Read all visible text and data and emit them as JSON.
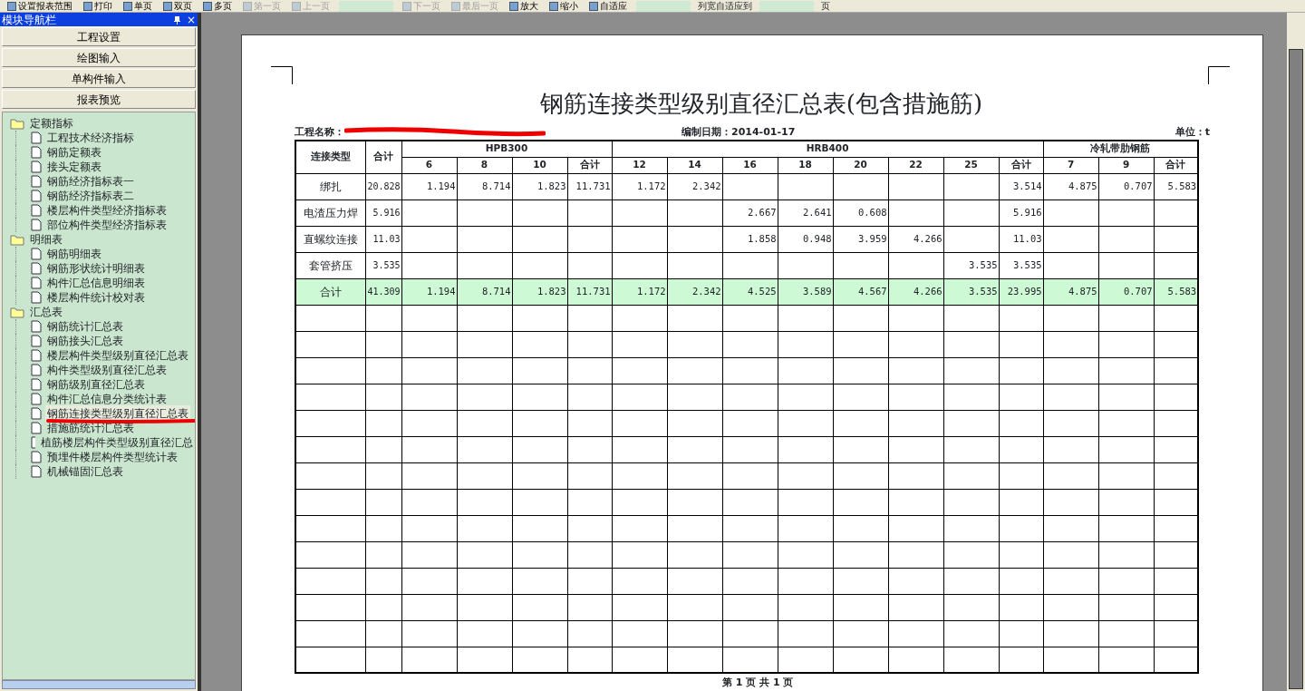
{
  "toolbar": [
    {
      "kind": "button",
      "label": "设置报表范围",
      "disabled": false
    },
    {
      "kind": "button",
      "label": "打印",
      "disabled": false
    },
    {
      "kind": "button",
      "label": "单页",
      "disabled": false
    },
    {
      "kind": "button",
      "label": "双页",
      "disabled": false
    },
    {
      "kind": "button",
      "label": "多页",
      "disabled": false
    },
    {
      "kind": "button",
      "label": "第一页",
      "disabled": true
    },
    {
      "kind": "button",
      "label": "上一页",
      "disabled": true
    },
    {
      "kind": "field"
    },
    {
      "kind": "button",
      "label": "下一页",
      "disabled": true
    },
    {
      "kind": "button",
      "label": "最后一页",
      "disabled": true
    },
    {
      "kind": "button",
      "label": "放大",
      "disabled": false
    },
    {
      "kind": "button",
      "label": "缩小",
      "disabled": false
    },
    {
      "kind": "button",
      "label": "自适应",
      "disabled": false
    },
    {
      "kind": "field"
    },
    {
      "kind": "text",
      "label": "列宽自适应到"
    },
    {
      "kind": "field"
    },
    {
      "kind": "text",
      "label": "页"
    }
  ],
  "panel": {
    "title": "模块导航栏",
    "close": "×",
    "sections": [
      {
        "label": "工程设置"
      },
      {
        "label": "绘图输入"
      },
      {
        "label": "单构件输入"
      },
      {
        "label": "报表预览"
      }
    ],
    "tree": [
      {
        "label": "定额指标",
        "children": [
          {
            "label": "工程技术经济指标",
            "selected": false
          },
          {
            "label": "钢筋定额表",
            "selected": false
          },
          {
            "label": "接头定额表",
            "selected": false
          },
          {
            "label": "钢筋经济指标表一",
            "selected": false
          },
          {
            "label": "钢筋经济指标表二",
            "selected": false
          },
          {
            "label": "楼层构件类型经济指标表",
            "selected": false
          },
          {
            "label": "部位构件类型经济指标表",
            "selected": false
          }
        ]
      },
      {
        "label": "明细表",
        "children": [
          {
            "label": "钢筋明细表",
            "selected": false
          },
          {
            "label": "钢筋形状统计明细表",
            "selected": false
          },
          {
            "label": "构件汇总信息明细表",
            "selected": false
          },
          {
            "label": "楼层构件统计校对表",
            "selected": false
          }
        ]
      },
      {
        "label": "汇总表",
        "children": [
          {
            "label": "钢筋统计汇总表",
            "selected": false
          },
          {
            "label": "钢筋接头汇总表",
            "selected": false
          },
          {
            "label": "楼层构件类型级别直径汇总表",
            "selected": false
          },
          {
            "label": "构件类型级别直径汇总表",
            "selected": false
          },
          {
            "label": "钢筋级别直径汇总表",
            "selected": false
          },
          {
            "label": "构件汇总信息分类统计表",
            "selected": false
          },
          {
            "label": "钢筋连接类型级别直径汇总表",
            "selected": true
          },
          {
            "label": "措施筋统计汇总表",
            "selected": false
          },
          {
            "label": "植筋楼层构件类型级别直径汇总",
            "selected": false
          },
          {
            "label": "预埋件楼层构件类型统计表",
            "selected": false
          },
          {
            "label": "机械锚固汇总表",
            "selected": false
          }
        ]
      }
    ]
  },
  "report": {
    "title": "钢筋连接类型级别直径汇总表(包含措施筋)",
    "project_label": "工程名称：",
    "date": "编制日期：2014-01-17",
    "unit": "单位：t",
    "table": {
      "first_column": "连接类型",
      "total_column": "合计",
      "groups": [
        {
          "label": "HPB300",
          "columns": [
            "6",
            "8",
            "10",
            "合计"
          ]
        },
        {
          "label": "HRB400",
          "columns": [
            "12",
            "14",
            "16",
            "18",
            "20",
            "22",
            "25",
            "合计"
          ]
        },
        {
          "label": "冷轧带肋钢筋",
          "columns": [
            "7",
            "9",
            "合计"
          ]
        }
      ],
      "rows": [
        {
          "kind": "data",
          "type": "绑扎",
          "total": "20.828",
          "cells": [
            "1.194",
            "8.714",
            "1.823",
            "11.731",
            "1.172",
            "2.342",
            null,
            null,
            null,
            null,
            null,
            "3.514",
            "4.875",
            "0.707",
            "5.583"
          ]
        },
        {
          "kind": "data",
          "type": "电渣压力焊",
          "total": "5.916",
          "cells": [
            null,
            null,
            null,
            null,
            null,
            null,
            "2.667",
            "2.641",
            "0.608",
            null,
            null,
            "5.916",
            null,
            null,
            null
          ]
        },
        {
          "kind": "data",
          "type": "直螺纹连接",
          "total": "11.03",
          "cells": [
            null,
            null,
            null,
            null,
            null,
            null,
            "1.858",
            "0.948",
            "3.959",
            "4.266",
            null,
            "11.03",
            null,
            null,
            null
          ]
        },
        {
          "kind": "data",
          "type": "套管挤压",
          "total": "3.535",
          "cells": [
            null,
            null,
            null,
            null,
            null,
            null,
            null,
            null,
            null,
            null,
            "3.535",
            "3.535",
            null,
            null,
            null
          ]
        },
        {
          "kind": "total",
          "type": "合计",
          "total": "41.309",
          "cells": [
            "1.194",
            "8.714",
            "1.823",
            "11.731",
            "1.172",
            "2.342",
            "4.525",
            "3.589",
            "4.567",
            "4.266",
            "3.535",
            "23.995",
            "4.875",
            "0.707",
            "5.583"
          ]
        }
      ]
    },
    "footer": "第 1 页 共 1 页"
  }
}
